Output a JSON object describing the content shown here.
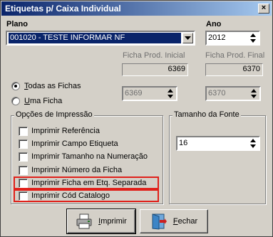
{
  "window": {
    "title": "Etiquetas p/ Caixa Individual",
    "close_glyph": "×"
  },
  "plano": {
    "label": "Plano",
    "value": "001020 - TESTE INFORMAR NF"
  },
  "ano": {
    "label": "Ano",
    "value": "2012"
  },
  "ficha_prod_inicial": {
    "label": "Ficha Prod. Inicial",
    "value": "6369"
  },
  "ficha_prod_final": {
    "label": "Ficha Prod. Final",
    "value": "6370"
  },
  "ficha_range": {
    "options": [
      {
        "label": "Todas as Fichas",
        "accel": "T",
        "rest": "odas as Fichas",
        "selected": true
      },
      {
        "label": "Uma Ficha",
        "accel": "U",
        "rest": "ma Ficha",
        "selected": false
      }
    ],
    "inicial_value": "6369",
    "final_value": "6370"
  },
  "opcoes": {
    "title": "Opções de Impressão",
    "items": [
      {
        "label": "Imprimir Referência",
        "checked": false
      },
      {
        "label": "Imprimir Campo Etiqueta",
        "checked": false
      },
      {
        "label": "Imprimir Tamanho na Numeração",
        "checked": false
      },
      {
        "label": "Imprimir Número da Ficha",
        "checked": false
      },
      {
        "label": "Imprimir Ficha em Etq. Separada",
        "checked": false
      },
      {
        "label": "Imprimir Cód Catalogo",
        "checked": false
      }
    ]
  },
  "tamanho_fonte": {
    "title": "Tamanho da Fonte",
    "value": "16"
  },
  "buttons": {
    "imprimir": {
      "accel": "I",
      "rest": "mprimir",
      "icon": "printer-icon"
    },
    "fechar": {
      "accel": "F",
      "rest": "echar",
      "icon": "exit-door-icon"
    }
  },
  "highlight_color": "#e0201a"
}
